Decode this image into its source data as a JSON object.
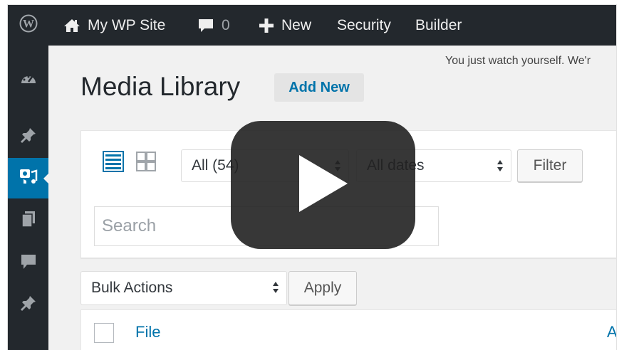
{
  "adminbar": {
    "site_name": "My WP Site",
    "comments_count": "0",
    "new_label": "New",
    "security_label": "Security",
    "builder_label": "Builder"
  },
  "notice": {
    "text": "You just watch yourself. We'r"
  },
  "page": {
    "title": "Media Library",
    "add_new_label": "Add New"
  },
  "filters": {
    "media_type": "All (54)",
    "dates": "All dates",
    "filter_button": "Filter",
    "search_placeholder": "Search"
  },
  "bulk": {
    "selected": "Bulk Actions",
    "apply_label": "Apply"
  },
  "table": {
    "columns": [
      "File",
      "Au"
    ]
  },
  "colors": {
    "adminbar_bg": "#23282d",
    "accent": "#0073aa",
    "page_bg": "#f1f1f1"
  },
  "icons": {
    "adminbar": [
      "wordpress-logo-icon",
      "home-icon",
      "comment-bubble-icon",
      "plus-icon"
    ],
    "sidebar": [
      "dashboard-icon",
      "pin-icon",
      "media-icon",
      "pages-icon",
      "comments-icon",
      "pin-icon"
    ],
    "overlay": "play-button-icon"
  }
}
